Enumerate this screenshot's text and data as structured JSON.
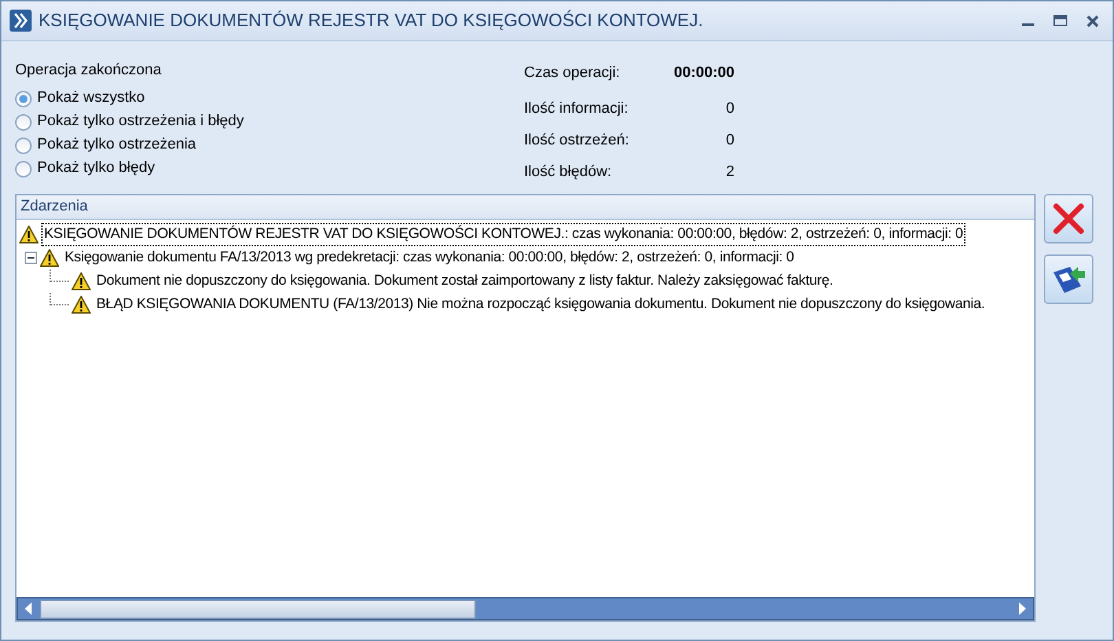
{
  "window": {
    "title": "KSIĘGOWANIE DOKUMENTÓW REJESTR VAT DO KSIĘGOWOŚCI KONTOWEJ."
  },
  "status": "Operacja zakończona",
  "filters": [
    {
      "label": "Pokaż wszystko",
      "selected": true
    },
    {
      "label": "Pokaż tylko ostrzeżenia i błędy",
      "selected": false
    },
    {
      "label": "Pokaż tylko ostrzeżenia",
      "selected": false
    },
    {
      "label": "Pokaż tylko błędy",
      "selected": false
    }
  ],
  "stats": [
    {
      "label": "Czas operacji:",
      "value": "00:00:00",
      "kind": "bold"
    },
    {
      "label": "Ilość informacji:",
      "value": "0",
      "kind": "plain"
    },
    {
      "label": "Ilość ostrzeżeń:",
      "value": "0",
      "kind": "plain"
    },
    {
      "label": "Ilość błędów:",
      "value": "2",
      "kind": "plain"
    }
  ],
  "events": {
    "header": "Zdarzenia",
    "items": [
      {
        "text": "KSIĘGOWANIE DOKUMENTÓW REJESTR VAT DO KSIĘGOWOŚCI KONTOWEJ.: czas wykonania: 00:00:00, błędów: 2, ostrzeżeń: 0, informacji: 0",
        "selected": true,
        "children": [
          {
            "text": "Księgowanie dokumentu FA/13/2013 wg predekretacji: czas wykonania: 00:00:00, błędów: 2, ostrzeżeń: 0, informacji: 0",
            "selected": false,
            "expanded": true,
            "children": [
              {
                "text": "Dokument nie dopuszczony do księgowania. Dokument został zaimportowany z listy faktur. Należy zaksięgować fakturę.",
                "selected": false
              },
              {
                "text": "BŁĄD KSIĘGOWANIA DOKUMENTU (FA/13/2013) Nie można rozpocząć księgowania dokumentu. Dokument nie dopuszczony do księgowania.",
                "selected": false
              }
            ]
          }
        ]
      }
    ]
  }
}
